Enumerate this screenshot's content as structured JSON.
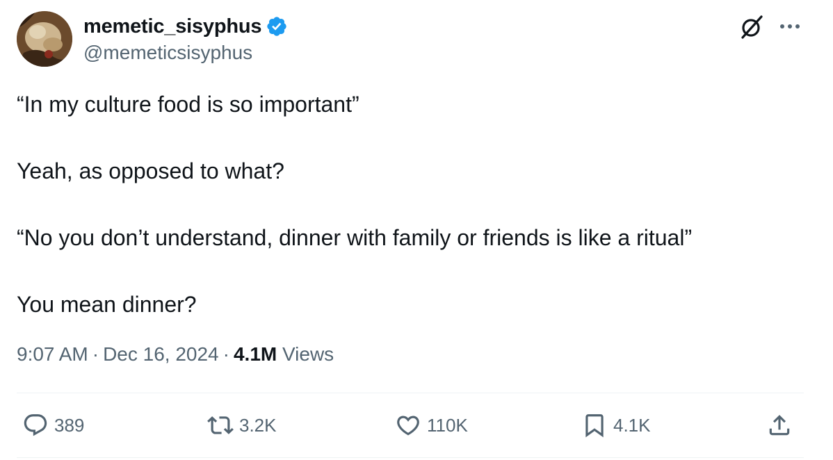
{
  "author": {
    "display_name": "memetic_sisyphus",
    "handle": "@memeticsisyphus",
    "verified": true
  },
  "tweet": {
    "paragraphs": [
      "“In my culture food is so important”",
      "Yeah, as opposed to what?",
      "“No you don’t understand, dinner with family or friends is like a ritual”",
      "You mean dinner?"
    ],
    "time": "9:07 AM",
    "date": "Dec 16, 2024",
    "separator": "·",
    "views_count": "4.1M",
    "views_label": "Views"
  },
  "actions": {
    "replies": "389",
    "reposts": "3.2K",
    "likes": "110K",
    "bookmarks": "4.1K"
  },
  "icons": {
    "top_right": [
      "grok-icon",
      "more-icon"
    ],
    "actions": [
      "reply-icon",
      "repost-icon",
      "like-icon",
      "bookmark-icon",
      "share-icon"
    ]
  },
  "colors": {
    "text_primary": "#0f1419",
    "text_secondary": "#536471",
    "verified_blue": "#1d9bf0",
    "divider": "#eff3f4"
  }
}
